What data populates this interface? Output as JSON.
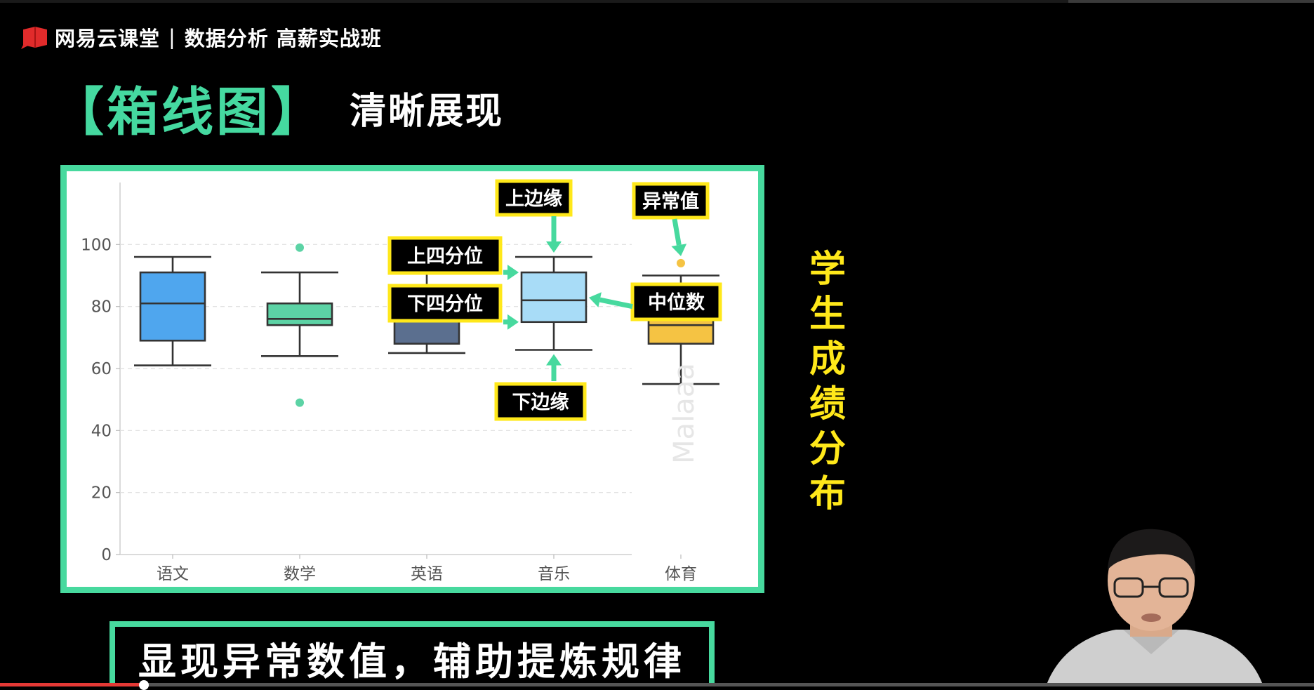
{
  "header": {
    "brand": "网易云课堂",
    "separator": "|",
    "course": "数据分析 高薪实战班"
  },
  "title": {
    "main": "【箱线图】",
    "sub": "清晰展现"
  },
  "side_title": [
    "学",
    "生",
    "成",
    "绩",
    "分",
    "布"
  ],
  "banner": "显现异常数值，辅助提炼规律",
  "annotations": {
    "upper_whisker": "上边缘",
    "outlier": "异常值",
    "upper_quartile": "上四分位",
    "median": "中位数",
    "lower_quartile": "下四分位",
    "lower_whisker": "下边缘"
  },
  "watermark": "Malaaa",
  "colors": {
    "accent": "#47d99e",
    "highlight": "#ffe81a",
    "progress": "#e53935"
  },
  "chart_data": {
    "type": "box",
    "categories": [
      "语文",
      "数学",
      "英语",
      "音乐",
      "体育"
    ],
    "ylim": [
      0,
      120
    ],
    "yticks": [
      0,
      20,
      40,
      60,
      80,
      100
    ],
    "grid": true,
    "series": [
      {
        "category": "语文",
        "min": 61,
        "q1": 69,
        "median": 81,
        "q3": 91,
        "max": 96,
        "outliers": [],
        "color": "#4fa6ee"
      },
      {
        "category": "数学",
        "min": 64,
        "q1": 74,
        "median": 76,
        "q3": 81,
        "max": 91,
        "outliers": [
          99,
          49
        ],
        "color": "#5cd3a5"
      },
      {
        "category": "英语",
        "min": 65,
        "q1": 68,
        "median": 80,
        "q3": 84,
        "max": 99,
        "outliers": [],
        "color": "#5b6f8f"
      },
      {
        "category": "音乐",
        "min": 66,
        "q1": 75,
        "median": 82,
        "q3": 91,
        "max": 96,
        "outliers": [],
        "color": "#a8dcf7"
      },
      {
        "category": "体育",
        "min": 55,
        "q1": 68,
        "median": 74,
        "q3": 77,
        "max": 90,
        "outliers": [
          94
        ],
        "color": "#f5c343"
      }
    ]
  }
}
